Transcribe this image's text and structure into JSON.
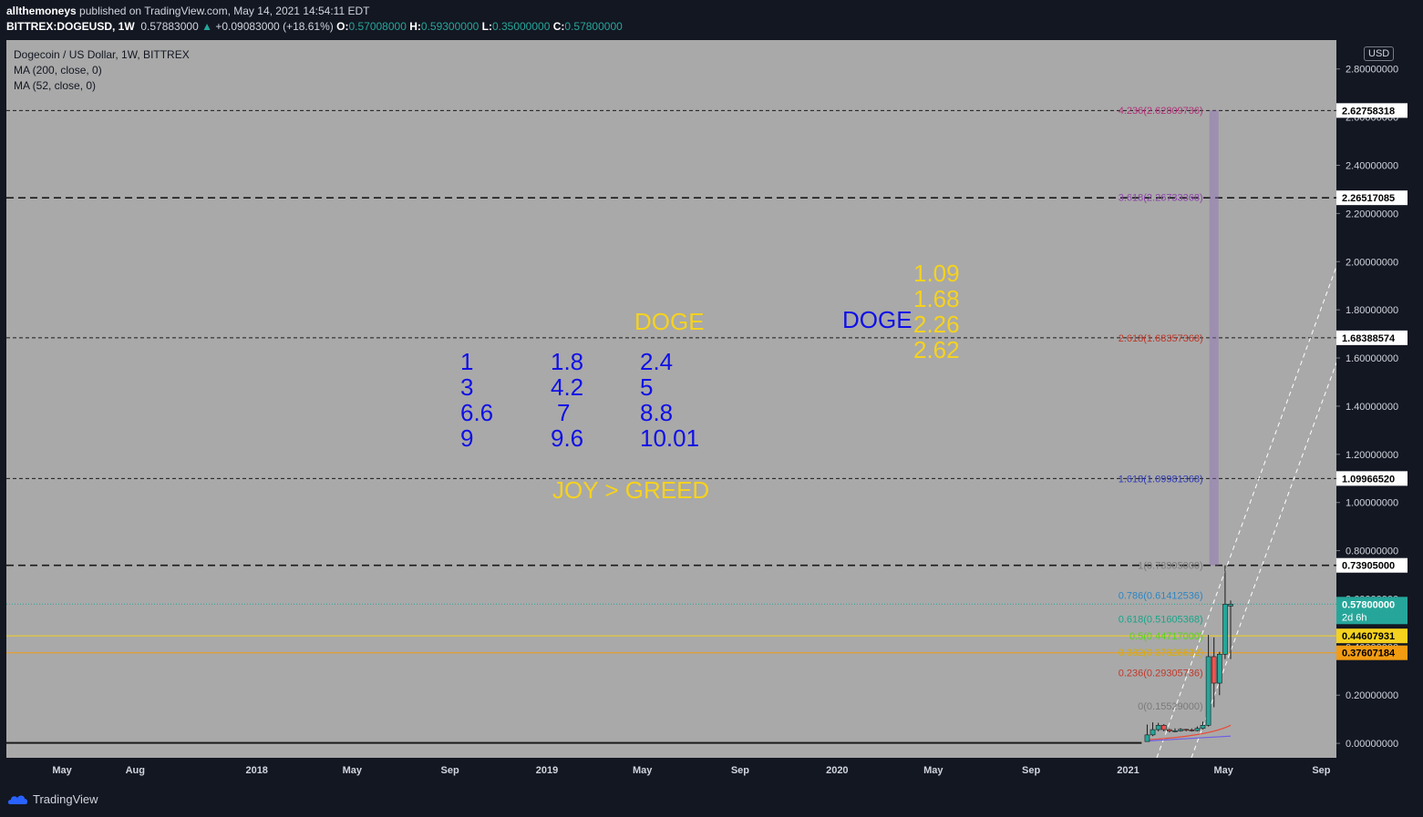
{
  "header": {
    "author": "allthemoneys",
    "published": "published on TradingView.com, May 14, 2021 14:54:11 EDT",
    "symbol": "BITTREX:DOGEUSD, 1W",
    "last": "0.57883000",
    "change": "+0.09083000 (+18.61%)",
    "o_label": "O:",
    "o": "0.57008000",
    "h_label": "H:",
    "h": "0.59300000",
    "l_label": "L:",
    "l": "0.35000000",
    "c_label": "C:",
    "c": "0.57800000"
  },
  "legend": {
    "title": "Dogecoin / US Dollar, 1W, BITTREX",
    "ma200": "MA (200, close, 0)",
    "ma52": "MA (52, close, 0)"
  },
  "currency_badge": "USD",
  "annotations": {
    "doge_left": "DOGE",
    "col1": [
      "1",
      "3",
      "6.6",
      "9"
    ],
    "col2": [
      "1.8",
      "4.2",
      "7",
      "9.6"
    ],
    "col3": [
      "2.4",
      "5",
      "8.8",
      "10.01"
    ],
    "joy": "JOY > GREED",
    "doge_right": "DOGE",
    "targets": [
      "1.09",
      "1.68",
      "2.26",
      "2.62"
    ]
  },
  "footer": {
    "brand": "TradingView"
  },
  "colors": {
    "background": "#a9a9a9",
    "up": "#26a69a",
    "down": "#ef5350",
    "price_line": "#26a69a"
  },
  "chart_data": {
    "type": "candlestick",
    "title": "Dogecoin / US Dollar, 1W, BITTREX",
    "ylim": [
      -0.06,
      2.92
    ],
    "y_ticks": [
      "0.00000000",
      "0.20000000",
      "0.40000000",
      "0.60000000",
      "0.80000000",
      "1.00000000",
      "1.20000000",
      "1.40000000",
      "1.60000000",
      "1.80000000",
      "2.00000000",
      "2.20000000",
      "2.40000000",
      "2.60000000",
      "2.80000000"
    ],
    "y_tick_values": [
      0,
      0.2,
      0.4,
      0.6,
      0.8,
      1.0,
      1.2,
      1.4,
      1.6,
      1.8,
      2.0,
      2.2,
      2.4,
      2.6,
      2.8
    ],
    "x_ticks": [
      {
        "label": "May",
        "date": "2017-05-01"
      },
      {
        "label": "Aug",
        "date": "2017-08-01"
      },
      {
        "label": "2018",
        "date": "2018-01-01"
      },
      {
        "label": "May",
        "date": "2018-05-01"
      },
      {
        "label": "Sep",
        "date": "2018-09-01"
      },
      {
        "label": "2019",
        "date": "2019-01-01"
      },
      {
        "label": "May",
        "date": "2019-05-01"
      },
      {
        "label": "Sep",
        "date": "2019-09-01"
      },
      {
        "label": "2020",
        "date": "2020-01-01"
      },
      {
        "label": "May",
        "date": "2020-05-01"
      },
      {
        "label": "Sep",
        "date": "2020-09-01"
      },
      {
        "label": "2021",
        "date": "2021-01-01"
      },
      {
        "label": "May",
        "date": "2021-05-01"
      },
      {
        "label": "Sep",
        "date": "2021-09-01"
      }
    ],
    "xlim": [
      "2017-02-20",
      "2021-09-20"
    ],
    "candles": [
      {
        "date": "2021-01-25",
        "o": 0.0075,
        "h": 0.078,
        "l": 0.0075,
        "c": 0.035
      },
      {
        "date": "2021-02-01",
        "o": 0.035,
        "h": 0.087,
        "l": 0.03,
        "c": 0.057
      },
      {
        "date": "2021-02-08",
        "o": 0.057,
        "h": 0.085,
        "l": 0.05,
        "c": 0.075
      },
      {
        "date": "2021-02-15",
        "o": 0.075,
        "h": 0.08,
        "l": 0.05,
        "c": 0.057
      },
      {
        "date": "2021-02-22",
        "o": 0.057,
        "h": 0.06,
        "l": 0.045,
        "c": 0.051
      },
      {
        "date": "2021-03-01",
        "o": 0.051,
        "h": 0.062,
        "l": 0.047,
        "c": 0.052
      },
      {
        "date": "2021-03-08",
        "o": 0.052,
        "h": 0.063,
        "l": 0.049,
        "c": 0.058
      },
      {
        "date": "2021-03-15",
        "o": 0.058,
        "h": 0.06,
        "l": 0.05,
        "c": 0.056
      },
      {
        "date": "2021-03-22",
        "o": 0.056,
        "h": 0.062,
        "l": 0.049,
        "c": 0.053
      },
      {
        "date": "2021-03-29",
        "o": 0.053,
        "h": 0.07,
        "l": 0.05,
        "c": 0.062
      },
      {
        "date": "2021-04-05",
        "o": 0.062,
        "h": 0.09,
        "l": 0.058,
        "c": 0.075
      },
      {
        "date": "2021-04-12",
        "o": 0.075,
        "h": 0.45,
        "l": 0.07,
        "c": 0.36
      },
      {
        "date": "2021-04-19",
        "o": 0.36,
        "h": 0.44,
        "l": 0.15,
        "c": 0.25
      },
      {
        "date": "2021-04-26",
        "o": 0.25,
        "h": 0.38,
        "l": 0.2,
        "c": 0.37
      },
      {
        "date": "2021-05-03",
        "o": 0.37,
        "h": 0.739,
        "l": 0.35,
        "c": 0.578
      },
      {
        "date": "2021-05-10",
        "o": 0.57,
        "h": 0.593,
        "l": 0.35,
        "c": 0.578
      }
    ],
    "hlines": [
      {
        "value": 2.62758318,
        "label": "2.62758318",
        "style": "dashed"
      },
      {
        "value": 2.26517085,
        "label": "2.26517085",
        "style": "dashed-heavy"
      },
      {
        "value": 1.68388574,
        "label": "1.68388574",
        "style": "dashed"
      },
      {
        "value": 1.0996652,
        "label": "1.09966520",
        "style": "dashed"
      },
      {
        "value": 0.73905,
        "label": "0.73905000",
        "style": "dashed-heavy"
      },
      {
        "value": 0.44607931,
        "label": "0.44607931",
        "style": "solid-yellow"
      },
      {
        "value": 0.37607184,
        "label": "0.37607184",
        "style": "solid-orange"
      }
    ],
    "last_price": {
      "value": 0.578,
      "label": "0.57800000",
      "countdown": "2d 6h"
    },
    "fib_levels": [
      {
        "ratio": "4.236",
        "value": 2.62809736,
        "text": "4.236(2.62809736)",
        "color": "#b2337a"
      },
      {
        "ratio": "3.618",
        "value": 2.26733368,
        "text": "3.618(2.26733368)",
        "color": "#8e44ad"
      },
      {
        "ratio": "2.618",
        "value": 1.68357368,
        "text": "2.618(1.68357368)",
        "color": "#c0392b"
      },
      {
        "ratio": "1.618",
        "value": 1.09981368,
        "text": "1.618(1.09981368)",
        "color": "#2f3bb5"
      },
      {
        "ratio": "1",
        "value": 0.73905,
        "text": "1(0.73905000)",
        "color": "#7a7a7a"
      },
      {
        "ratio": "0.786",
        "value": 0.61412536,
        "text": "0.786(0.61412536)",
        "color": "#2e86c1"
      },
      {
        "ratio": "0.618",
        "value": 0.51605368,
        "text": "0.618(0.51605368)",
        "color": "#17a589"
      },
      {
        "ratio": "0.5",
        "value": 0.44717,
        "text": "0.5(0.44717000)",
        "color": "#58d617"
      },
      {
        "ratio": "0.382",
        "value": 0.37828632,
        "text": "0.382(0.37828632)",
        "color": "#d4ac0d"
      },
      {
        "ratio": "0.236",
        "value": 0.29305736,
        "text": "0.236(0.29305736)",
        "color": "#c0392b"
      },
      {
        "ratio": "0",
        "value": 0.15529,
        "text": "0(0.15529000)",
        "color": "#7a7a7a"
      }
    ]
  }
}
